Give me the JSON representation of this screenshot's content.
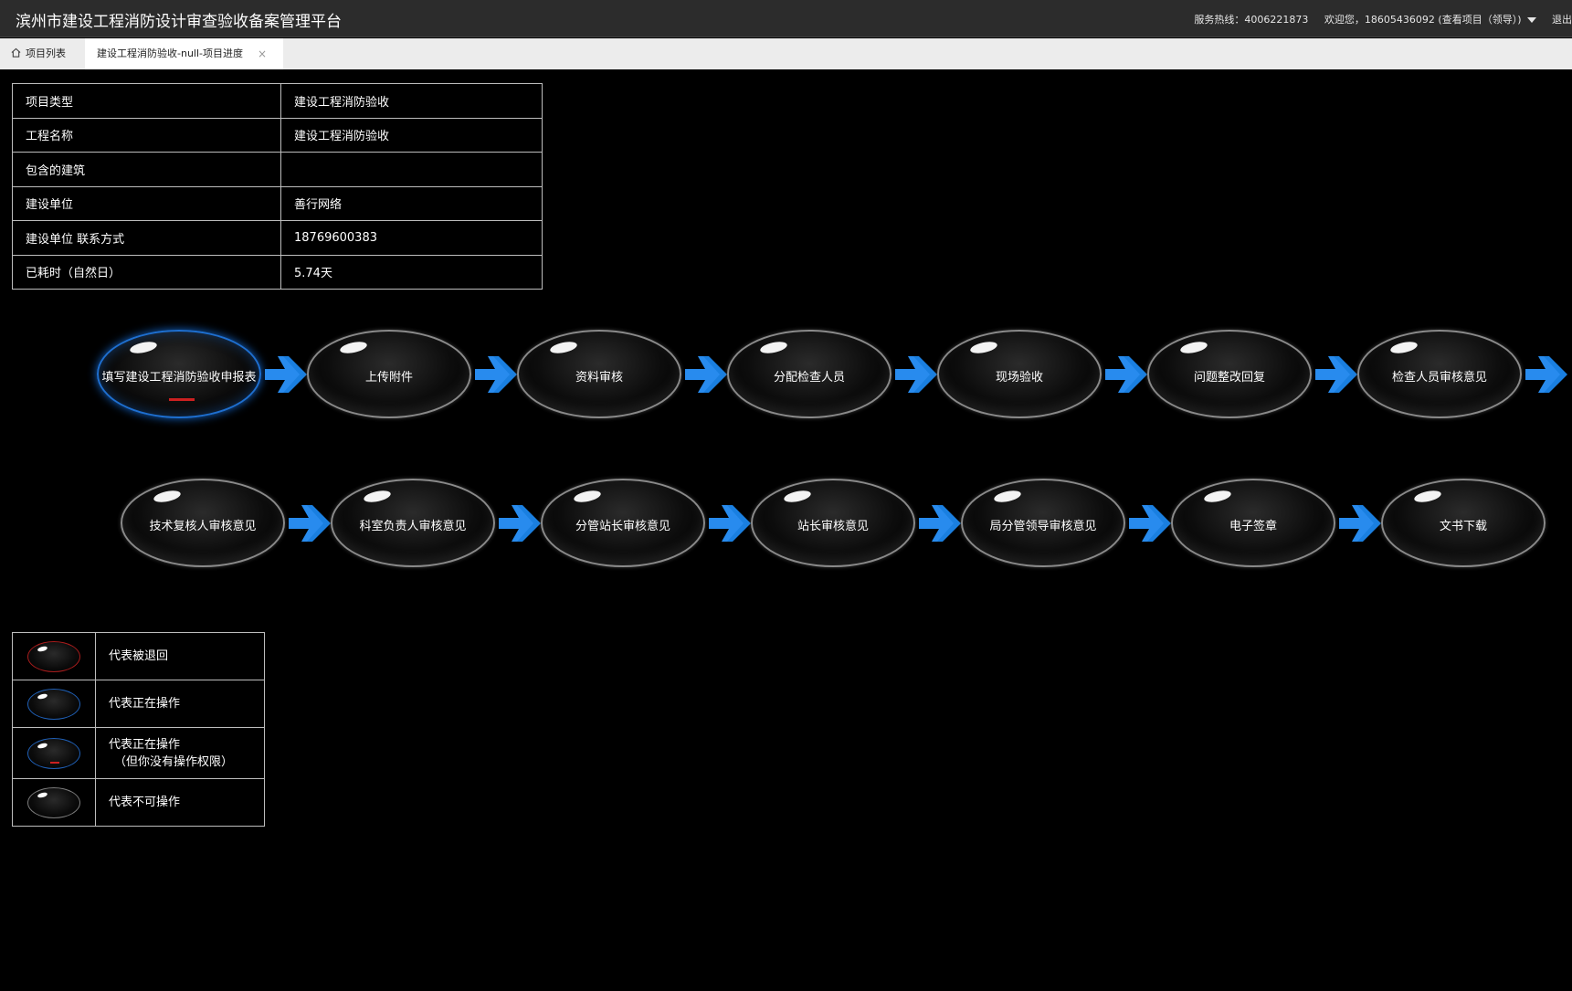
{
  "header": {
    "title": "滨州市建设工程消防设计审查验收备案管理平台",
    "hotline": "服务热线：4006221873",
    "welcome": "欢迎您，18605436092 (查看项目（领导）)",
    "logout": "退出"
  },
  "tabs": {
    "home_label": "项目列表",
    "active_label": "建设工程消防验收-null-项目进度",
    "close_glyph": "×"
  },
  "project_info": [
    {
      "key": "项目类型",
      "value": "建设工程消防验收"
    },
    {
      "key": "工程名称",
      "value": "建设工程消防验收"
    },
    {
      "key": "包含的建筑",
      "value": ""
    },
    {
      "key": "建设单位",
      "value": "善行网络"
    },
    {
      "key": "建设单位 联系方式",
      "value": "18769600383"
    },
    {
      "key": "已耗时（自然日）",
      "value": "5.74天"
    }
  ],
  "workflow": {
    "row1": [
      {
        "label": "填写建设工程消防验收申报表",
        "state": "active-no-permission"
      },
      {
        "label": "上传附件",
        "state": "disabled"
      },
      {
        "label": "资料审核",
        "state": "disabled"
      },
      {
        "label": "分配检查人员",
        "state": "disabled"
      },
      {
        "label": "现场验收",
        "state": "disabled"
      },
      {
        "label": "问题整改回复",
        "state": "disabled"
      },
      {
        "label": "检查人员审核意见",
        "state": "disabled"
      }
    ],
    "row2": [
      {
        "label": "技术复核人审核意见",
        "state": "disabled"
      },
      {
        "label": "科室负责人审核意见",
        "state": "disabled"
      },
      {
        "label": "分管站长审核意见",
        "state": "disabled"
      },
      {
        "label": "站长审核意见",
        "state": "disabled"
      },
      {
        "label": "局分管领导审核意见",
        "state": "disabled"
      },
      {
        "label": "电子签章",
        "state": "disabled"
      },
      {
        "label": "文书下载",
        "state": "disabled"
      }
    ]
  },
  "legend": [
    {
      "icon": "returned-node-icon",
      "color": "#a81c1c",
      "text": "代表被退回"
    },
    {
      "icon": "operating-node-icon",
      "color": "#1f5fb5",
      "text": "代表正在操作"
    },
    {
      "icon": "operating-no-permission-node-icon",
      "color": "#1f5fb5",
      "text": "代表正在操作",
      "text2": "（但你没有操作权限）"
    },
    {
      "icon": "disabled-node-icon",
      "color": "#7c7c7c",
      "text": "代表不可操作"
    }
  ],
  "colors": {
    "arrow": "#1a7fe0",
    "active_border": "#1e6fd0",
    "returned": "#cc2020",
    "background": "#000000"
  }
}
